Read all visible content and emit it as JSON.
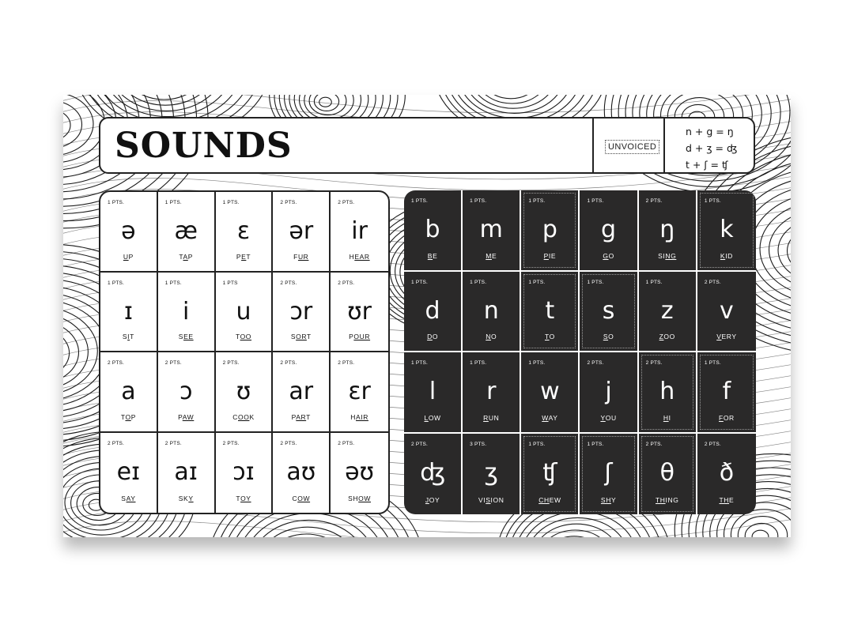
{
  "header": {
    "title": "SOUNDS",
    "unvoiced_label": "UNVOICED",
    "combos": [
      "n + g = ŋ",
      "d + ʒ = ʤ",
      "t + ʃ = ʧ"
    ]
  },
  "vowels": [
    {
      "pts": "1 PTS.",
      "sym": "ə",
      "pre": "",
      "ul": "U",
      "post": "P"
    },
    {
      "pts": "1 PTS.",
      "sym": "æ",
      "pre": "T",
      "ul": "A",
      "post": "P"
    },
    {
      "pts": "1 PTS.",
      "sym": "ɛ",
      "pre": "P",
      "ul": "E",
      "post": "T"
    },
    {
      "pts": "2 PTS.",
      "sym": "ər",
      "pre": "F",
      "ul": "UR",
      "post": ""
    },
    {
      "pts": "2 PTS.",
      "sym": "ir",
      "pre": "H",
      "ul": "EAR",
      "post": ""
    },
    {
      "pts": "1 PTS.",
      "sym": "ɪ",
      "pre": "S",
      "ul": "I",
      "post": "T"
    },
    {
      "pts": "1 PTS.",
      "sym": "i",
      "pre": "S",
      "ul": "EE",
      "post": ""
    },
    {
      "pts": "1 PTS",
      "sym": "u",
      "pre": "T",
      "ul": "OO",
      "post": ""
    },
    {
      "pts": "2 PTS.",
      "sym": "ɔr",
      "pre": "S",
      "ul": "OR",
      "post": "T"
    },
    {
      "pts": "2 PTS.",
      "sym": "ʊr",
      "pre": "P",
      "ul": "OUR",
      "post": ""
    },
    {
      "pts": "2 PTS.",
      "sym": "a",
      "pre": "T",
      "ul": "O",
      "post": "P"
    },
    {
      "pts": "2 PTS.",
      "sym": "ɔ",
      "pre": "P",
      "ul": "AW",
      "post": ""
    },
    {
      "pts": "2 PTS.",
      "sym": "ʊ",
      "pre": "C",
      "ul": "OO",
      "post": "K"
    },
    {
      "pts": "2 PTS.",
      "sym": "ar",
      "pre": "P",
      "ul": "AR",
      "post": "T"
    },
    {
      "pts": "2 PTS.",
      "sym": "ɛr",
      "pre": "H",
      "ul": "AIR",
      "post": ""
    },
    {
      "pts": "2 PTS.",
      "sym": "eɪ",
      "pre": "S",
      "ul": "AY",
      "post": ""
    },
    {
      "pts": "2 PTS.",
      "sym": "aɪ",
      "pre": "SK",
      "ul": "Y",
      "post": ""
    },
    {
      "pts": "2 PTS.",
      "sym": "ɔɪ",
      "pre": "T",
      "ul": "OY",
      "post": ""
    },
    {
      "pts": "2 PTS.",
      "sym": "aʊ",
      "pre": "C",
      "ul": "OW",
      "post": ""
    },
    {
      "pts": "2 PTS.",
      "sym": "əʊ",
      "pre": "SH",
      "ul": "OW",
      "post": ""
    }
  ],
  "consonants": [
    {
      "pts": "1 PTS.",
      "sym": "b",
      "pre": "",
      "ul": "B",
      "post": "E",
      "unvoiced": false
    },
    {
      "pts": "1 PTS.",
      "sym": "m",
      "pre": "",
      "ul": "M",
      "post": "E",
      "unvoiced": false
    },
    {
      "pts": "1 PTS.",
      "sym": "p",
      "pre": "",
      "ul": "P",
      "post": "IE",
      "unvoiced": true
    },
    {
      "pts": "1 PTS.",
      "sym": "g",
      "pre": "",
      "ul": "G",
      "post": "O",
      "unvoiced": false
    },
    {
      "pts": "2 PTS.",
      "sym": "ŋ",
      "pre": "SI",
      "ul": "NG",
      "post": "",
      "unvoiced": false
    },
    {
      "pts": "1 PTS.",
      "sym": "k",
      "pre": "",
      "ul": "K",
      "post": "ID",
      "unvoiced": true
    },
    {
      "pts": "1 PTS.",
      "sym": "d",
      "pre": "",
      "ul": "D",
      "post": "O",
      "unvoiced": false
    },
    {
      "pts": "1 PTS.",
      "sym": "n",
      "pre": "",
      "ul": "N",
      "post": "O",
      "unvoiced": false
    },
    {
      "pts": "1 PTS.",
      "sym": "t",
      "pre": "",
      "ul": "T",
      "post": "O",
      "unvoiced": true
    },
    {
      "pts": "1 PTS.",
      "sym": "s",
      "pre": "",
      "ul": "S",
      "post": "O",
      "unvoiced": true
    },
    {
      "pts": "1 PTS.",
      "sym": "z",
      "pre": "",
      "ul": "Z",
      "post": "OO",
      "unvoiced": false
    },
    {
      "pts": "2 PTS.",
      "sym": "v",
      "pre": "",
      "ul": "V",
      "post": "ERY",
      "unvoiced": false
    },
    {
      "pts": "1 PTS.",
      "sym": "l",
      "pre": "",
      "ul": "L",
      "post": "OW",
      "unvoiced": false
    },
    {
      "pts": "1 PTS.",
      "sym": "r",
      "pre": "",
      "ul": "R",
      "post": "UN",
      "unvoiced": false
    },
    {
      "pts": "1 PTS.",
      "sym": "w",
      "pre": "",
      "ul": "W",
      "post": "AY",
      "unvoiced": false
    },
    {
      "pts": "2 PTS.",
      "sym": "j",
      "pre": "",
      "ul": "Y",
      "post": "OU",
      "unvoiced": false
    },
    {
      "pts": "2 PTS.",
      "sym": "h",
      "pre": "",
      "ul": "H",
      "post": "I",
      "unvoiced": true
    },
    {
      "pts": "1 PTS.",
      "sym": "f",
      "pre": "",
      "ul": "F",
      "post": "OR",
      "unvoiced": true
    },
    {
      "pts": "2 PTS.",
      "sym": "ʤ",
      "pre": "",
      "ul": "J",
      "post": "OY",
      "unvoiced": false
    },
    {
      "pts": "3 PTS.",
      "sym": "ʒ",
      "pre": "VI",
      "ul": "S",
      "post": "ION",
      "unvoiced": false
    },
    {
      "pts": "1 PTS.",
      "sym": "ʧ",
      "pre": "",
      "ul": "CH",
      "post": "EW",
      "unvoiced": true
    },
    {
      "pts": "1 PTS.",
      "sym": "ʃ",
      "pre": "",
      "ul": "SH",
      "post": "Y",
      "unvoiced": true
    },
    {
      "pts": "2 PTS.",
      "sym": "θ",
      "pre": "",
      "ul": "TH",
      "post": "ING",
      "unvoiced": true
    },
    {
      "pts": "2 PTS.",
      "sym": "ð",
      "pre": "",
      "ul": "TH",
      "post": "E",
      "unvoiced": false
    }
  ]
}
